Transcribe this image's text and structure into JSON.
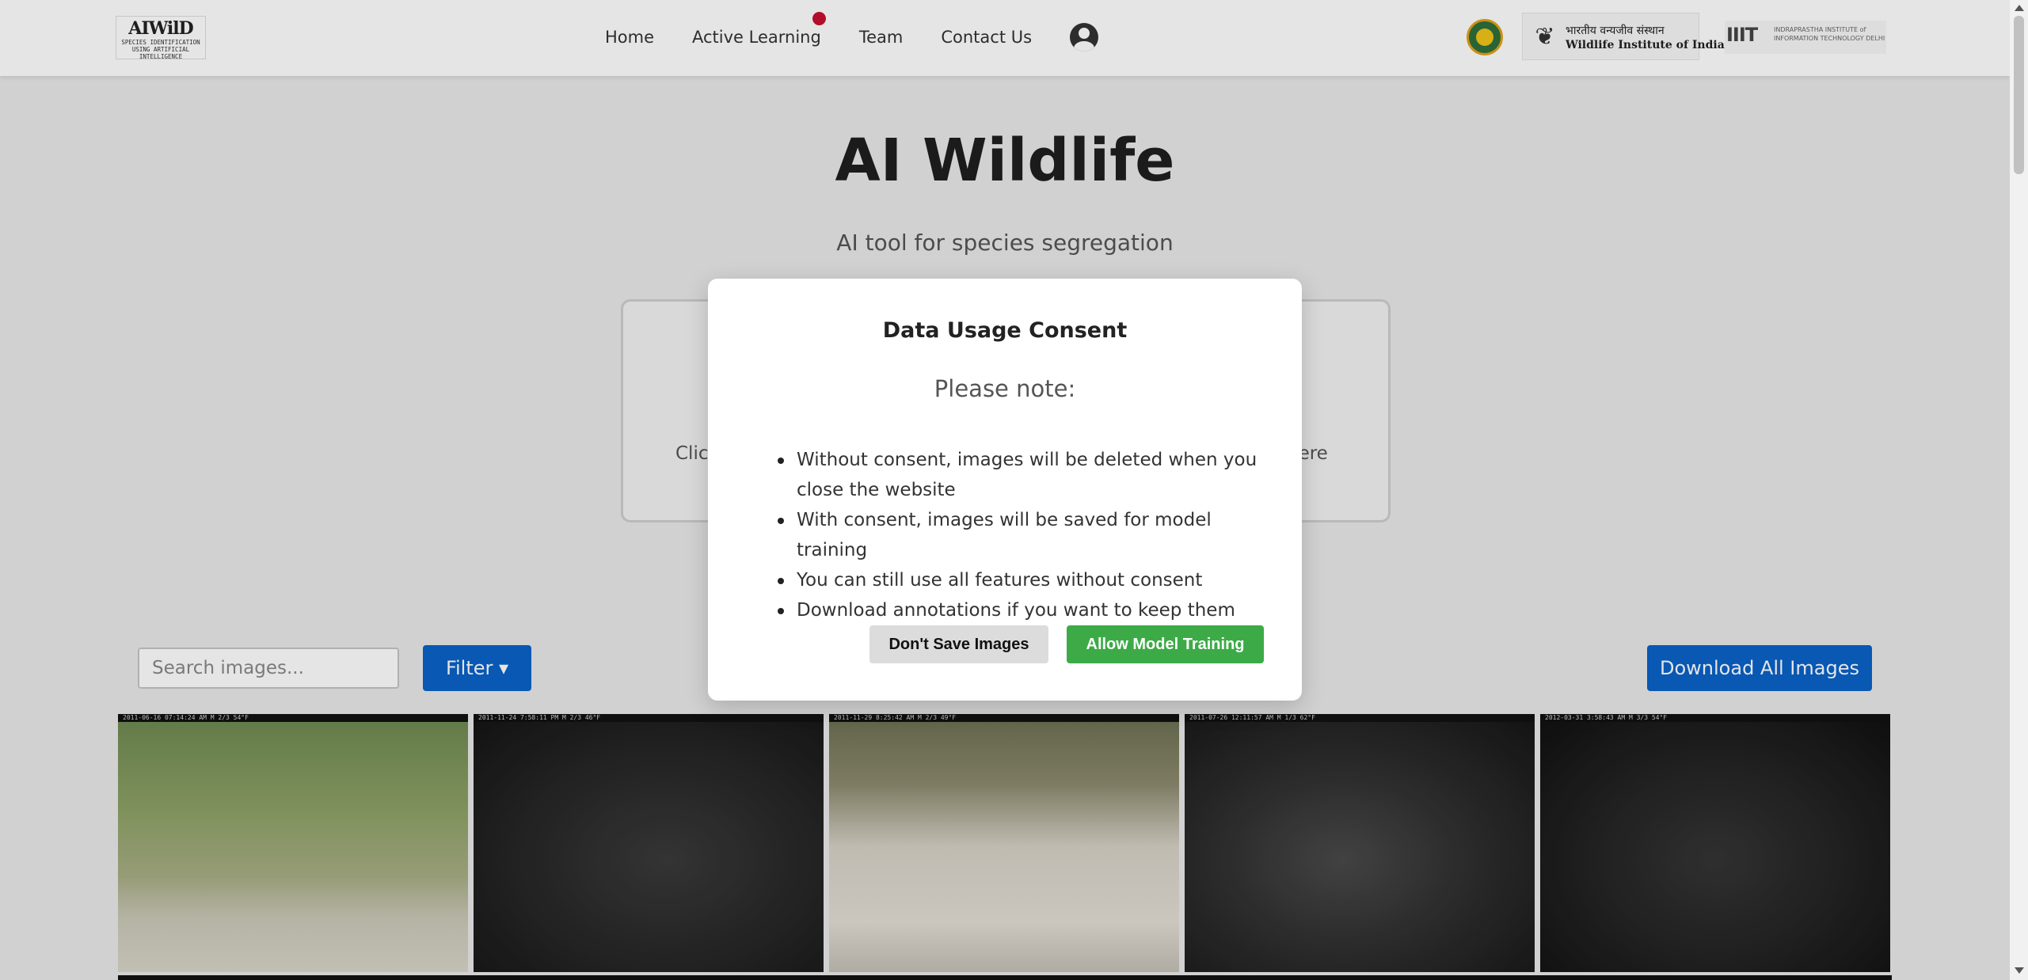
{
  "header": {
    "logo": {
      "title": "AIWilD",
      "subtitle_line1": "SPECIES IDENTIFICATION",
      "subtitle_line2": "USING ARTIFICIAL INTELLIGENCE"
    },
    "nav": [
      {
        "label": "Home"
      },
      {
        "label": "Active Learning",
        "has_notification_dot": true
      },
      {
        "label": "Team"
      },
      {
        "label": "Contact Us"
      }
    ],
    "profile_icon": "user-circle-icon",
    "partners": {
      "wii_hindi": "भारतीय वन्यजीव संस्थान",
      "wii_english": "Wildlife Institute of India",
      "iiitd_mark": "IIIT",
      "iiitd_text": "INDRAPRASTHA INSTITUTE of INFORMATION TECHNOLOGY DELHI"
    }
  },
  "hero": {
    "title": "AI Wildlife",
    "subtitle": "AI tool for species segregation",
    "dropzone_left_text": "Clic",
    "dropzone_right_text": "here"
  },
  "toolbar": {
    "search_placeholder": "Search images...",
    "filter_label": "Filter ▾",
    "download_label": "Download All Images"
  },
  "gallery": {
    "thumbnails": [
      {
        "stamp": "2011-06-16 07:14:24 AM  M 2/3   54°F"
      },
      {
        "stamp": "2011-11-24 7:58:11 PM  M 2/3   46°F"
      },
      {
        "stamp": "2011-11-29 8:25:42 AM  M 2/3   49°F"
      },
      {
        "stamp": "2011-07-26 12:11:57 AM  M 1/3   62°F"
      },
      {
        "stamp": "2012-03-31 3:58:43 AM  M 3/3   54°F"
      }
    ]
  },
  "modal": {
    "title": "Data Usage Consent",
    "note": "Please note:",
    "items": [
      "Without consent, images will be deleted when you close the website",
      "With consent, images will be saved for model training",
      "You can still use all features without consent",
      "Download annotations if you want to keep them"
    ],
    "decline_label": "Don't Save Images",
    "accept_label": "Allow Model Training"
  },
  "colors": {
    "primary_blue": "#0a62c9",
    "accept_green": "#3cab47",
    "notification_red": "#c8102e"
  }
}
